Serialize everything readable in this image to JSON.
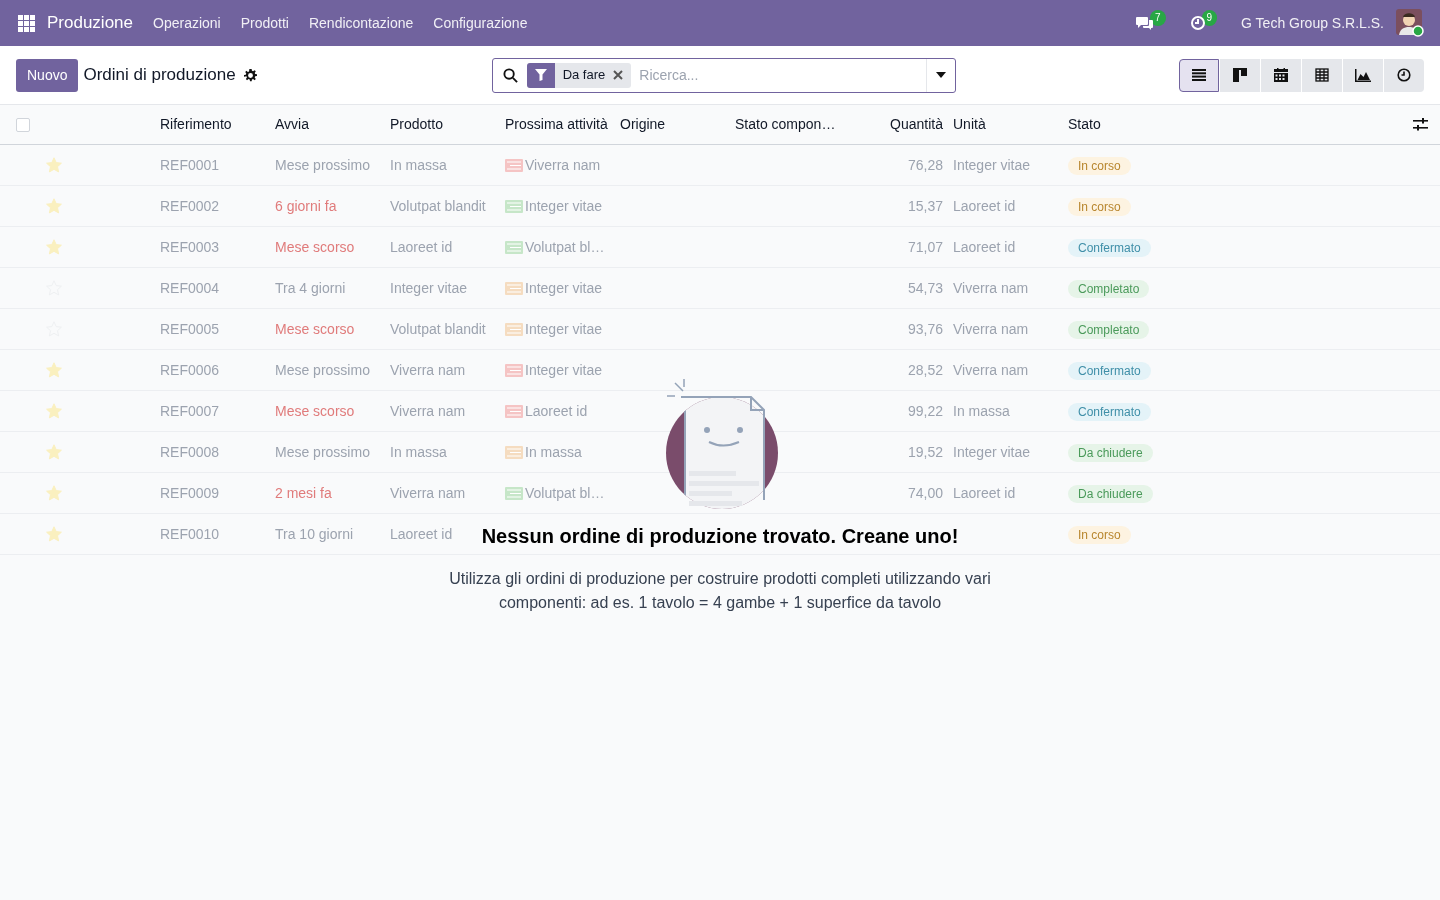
{
  "navbar": {
    "app_name": "Produzione",
    "menu": [
      "Operazioni",
      "Prodotti",
      "Rendicontazione",
      "Configurazione"
    ],
    "messages_count": "7",
    "activities_count": "9",
    "company": "G Tech Group S.R.L.S."
  },
  "control_panel": {
    "new_button": "Nuovo",
    "title": "Ordini di produzione",
    "search": {
      "facets": [
        {
          "label": "Da fare"
        }
      ],
      "placeholder": "Ricerca..."
    },
    "views": [
      {
        "kind": "list",
        "selected": true
      },
      {
        "kind": "kanban",
        "selected": false
      },
      {
        "kind": "calendar",
        "selected": false
      },
      {
        "kind": "pivot",
        "selected": false
      },
      {
        "kind": "graph",
        "selected": false
      },
      {
        "kind": "activity",
        "selected": false
      }
    ]
  },
  "table": {
    "select_all_checked": false,
    "columns": [
      "Riferimento",
      "Avvia",
      "Prodotto",
      "Prossima attività",
      "Origine",
      "Stato compon…",
      "Quantità",
      "Unità",
      "Stato"
    ],
    "rows": [
      {
        "starred": true,
        "reference": "REF0001",
        "start": "Mese prossimo",
        "start_overdue": false,
        "product": "In massa",
        "activity": "Viverra nam",
        "color": "#f5c4c4",
        "quantity": "76,28",
        "unit": "Integer vitae",
        "status": {
          "label": "In corso",
          "kind": "warning"
        }
      },
      {
        "starred": true,
        "reference": "REF0002",
        "start": "6 giorni fa",
        "start_overdue": true,
        "product": "Volutpat blandit",
        "activity": "Integer vitae",
        "color": "#c6e6c8",
        "quantity": "15,37",
        "unit": "Laoreet id",
        "status": {
          "label": "In corso",
          "kind": "warning"
        }
      },
      {
        "starred": true,
        "reference": "REF0003",
        "start": "Mese scorso",
        "start_overdue": true,
        "product": "Laoreet id",
        "activity": "Volutpat bl…",
        "color": "#c6e6c8",
        "quantity": "71,07",
        "unit": "Laoreet id",
        "status": {
          "label": "Confermato",
          "kind": "info"
        }
      },
      {
        "starred": false,
        "reference": "REF0004",
        "start": "Tra 4 giorni",
        "start_overdue": false,
        "product": "Integer vitae",
        "activity": "Integer vitae",
        "color": "#f5dcc0",
        "quantity": "54,73",
        "unit": "Viverra nam",
        "status": {
          "label": "Completato",
          "kind": "success"
        }
      },
      {
        "starred": false,
        "reference": "REF0005",
        "start": "Mese scorso",
        "start_overdue": true,
        "product": "Volutpat blandit",
        "activity": "Integer vitae",
        "color": "#f5dcc0",
        "quantity": "93,76",
        "unit": "Viverra nam",
        "status": {
          "label": "Completato",
          "kind": "success"
        }
      },
      {
        "starred": true,
        "reference": "REF0006",
        "start": "Mese prossimo",
        "start_overdue": false,
        "product": "Viverra nam",
        "activity": "Integer vitae",
        "color": "#f5c4c4",
        "quantity": "28,52",
        "unit": "Viverra nam",
        "status": {
          "label": "Confermato",
          "kind": "info"
        }
      },
      {
        "starred": true,
        "reference": "REF0007",
        "start": "Mese scorso",
        "start_overdue": true,
        "product": "Viverra nam",
        "activity": "Laoreet id",
        "color": "#f5c4c4",
        "quantity": "99,22",
        "unit": "In massa",
        "status": {
          "label": "Confermato",
          "kind": "info"
        }
      },
      {
        "starred": true,
        "reference": "REF0008",
        "start": "Mese prossimo",
        "start_overdue": false,
        "product": "In massa",
        "activity": "In massa",
        "color": "#f5dcc0",
        "quantity": "19,52",
        "unit": "Integer vitae",
        "status": {
          "label": "Da chiudere",
          "kind": "success"
        }
      },
      {
        "starred": true,
        "reference": "REF0009",
        "start": "2 mesi fa",
        "start_overdue": true,
        "product": "Viverra nam",
        "activity": "Volutpat bl…",
        "color": "#c6e6c8",
        "quantity": "74,00",
        "unit": "Laoreet id",
        "status": {
          "label": "Da chiudere",
          "kind": "success"
        }
      },
      {
        "starred": true,
        "reference": "REF0010",
        "start": "Tra 10 giorni",
        "start_overdue": false,
        "product": "Laoreet id",
        "status": {
          "label": "In corso",
          "kind": "warning"
        }
      }
    ]
  },
  "empty_state": {
    "title": "Nessun ordine di produzione trovato. Creane uno!",
    "description": "Utilizza gli ordini di produzione per costruire prodotti completi utilizzando vari componenti: ad es. 1 tavolo = 4 gambe + 1 superfice da tavolo"
  }
}
